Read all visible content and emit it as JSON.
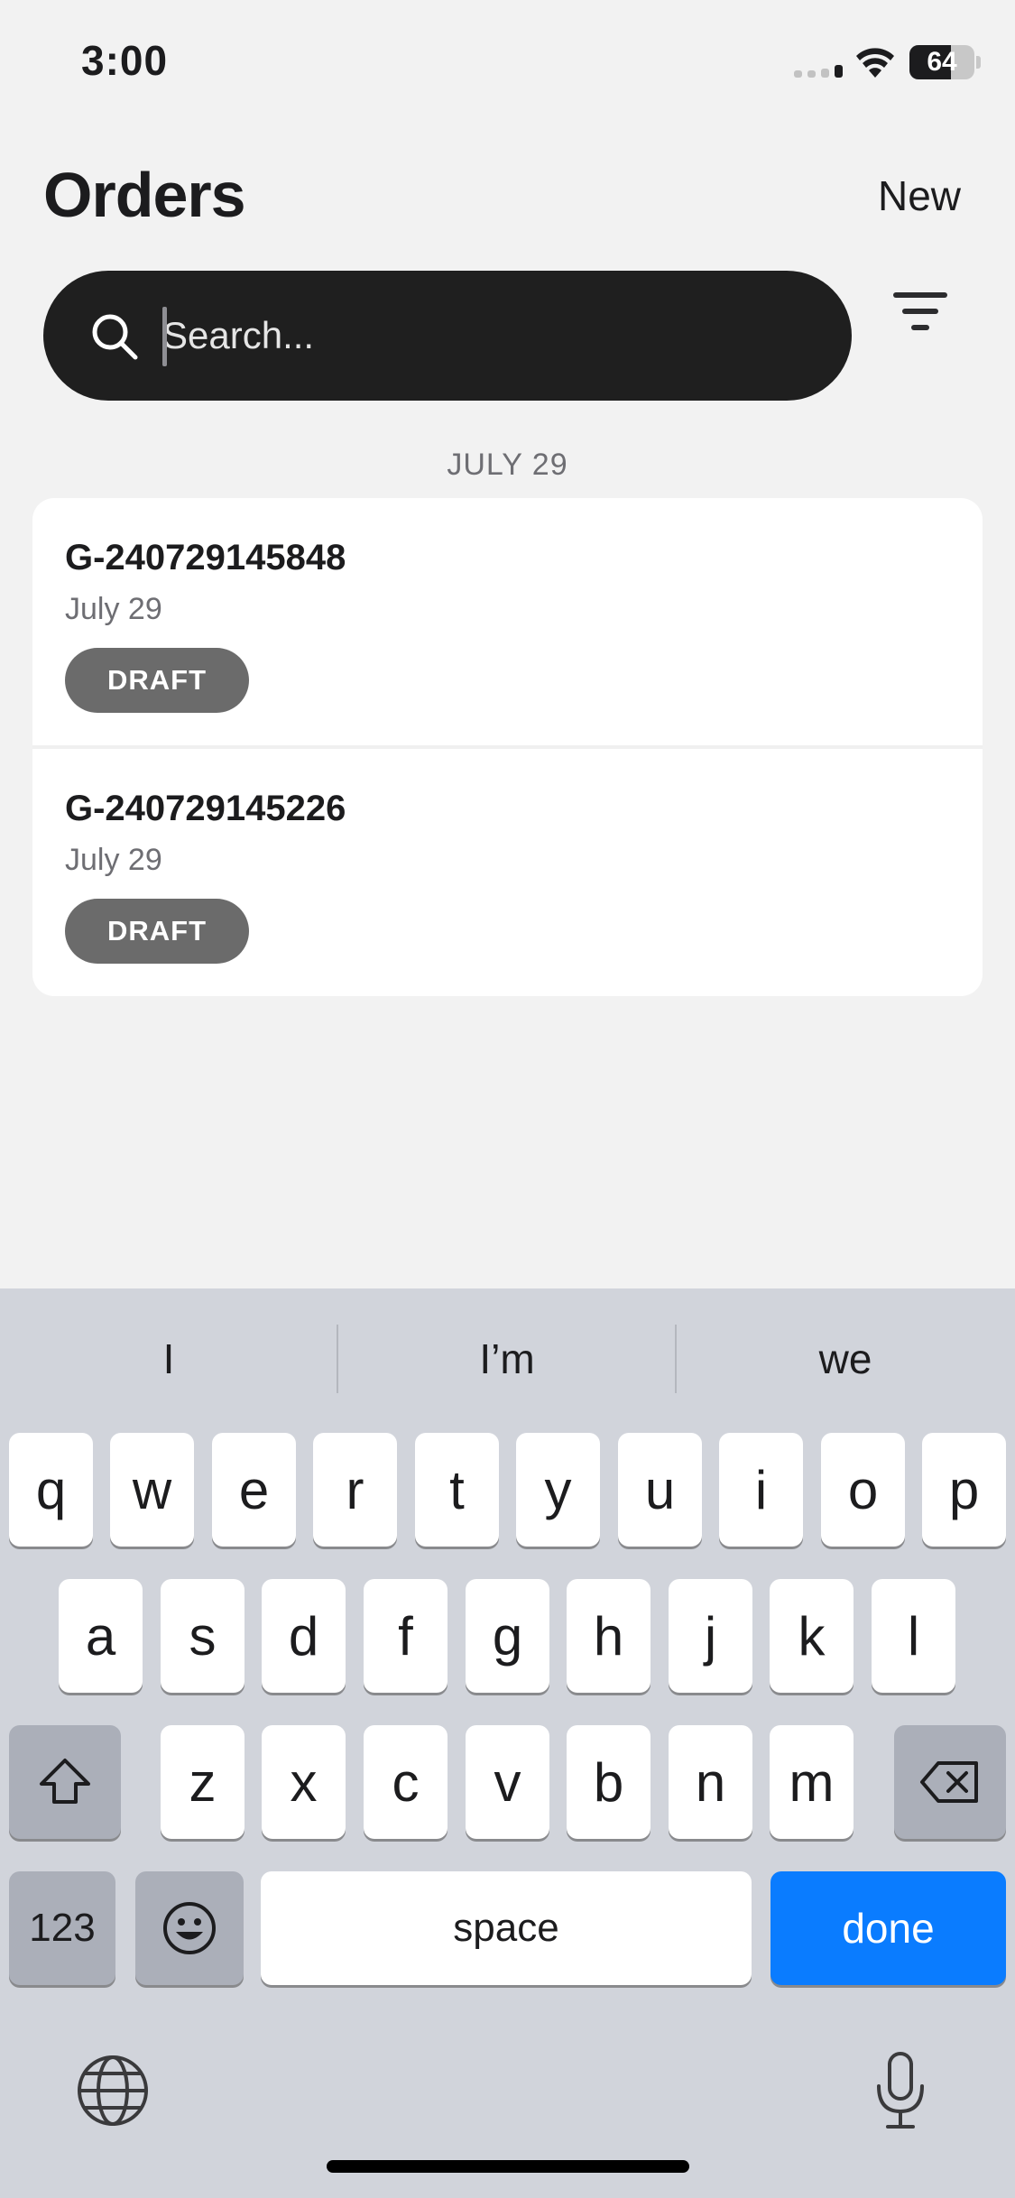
{
  "status_bar": {
    "time": "3:00",
    "battery": "64"
  },
  "header": {
    "title": "Orders",
    "new_label": "New"
  },
  "search": {
    "placeholder": "Search..."
  },
  "section": {
    "date": "JULY 29"
  },
  "orders": [
    {
      "id": "G-240729145848",
      "date": "July 29",
      "status": "DRAFT"
    },
    {
      "id": "G-240729145226",
      "date": "July 29",
      "status": "DRAFT"
    }
  ],
  "keyboard": {
    "suggestions": [
      "I",
      "I’m",
      "we"
    ],
    "row1": [
      "q",
      "w",
      "e",
      "r",
      "t",
      "y",
      "u",
      "i",
      "o",
      "p"
    ],
    "row2": [
      "a",
      "s",
      "d",
      "f",
      "g",
      "h",
      "j",
      "k",
      "l"
    ],
    "row3": [
      "z",
      "x",
      "c",
      "v",
      "b",
      "n",
      "m"
    ],
    "numbers_label": "123",
    "space_label": "space",
    "done_label": "done"
  },
  "colors": {
    "accent": "#0a7cff",
    "badge": "#6b6b6b",
    "search_bg": "#1f1f1f",
    "keyboard_bg": "#d1d4db"
  }
}
